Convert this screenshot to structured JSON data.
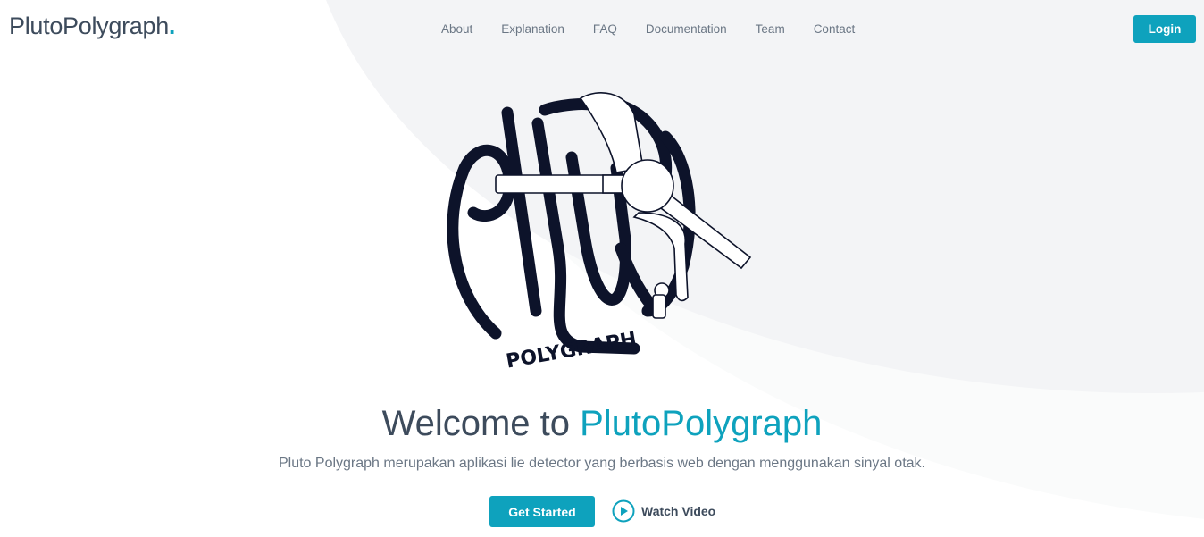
{
  "header": {
    "brand": "PlutoPolygraph",
    "brand_dot": ".",
    "nav": [
      "About",
      "Explanation",
      "FAQ",
      "Documentation",
      "Team",
      "Contact"
    ],
    "login": "Login"
  },
  "hero": {
    "logo_text": "POLYGRAPH",
    "title_prefix": "Welcome to ",
    "title_accent": "PlutoPolygraph",
    "subtitle": "Pluto Polygraph merupakan aplikasi lie detector yang berbasis web dengan menggunakan sinyal otak.",
    "get_started": "Get Started",
    "watch_video": "Watch Video"
  },
  "colors": {
    "accent": "#0ea2bd",
    "text": "#3d4b5c",
    "logo": "#0d132a"
  }
}
